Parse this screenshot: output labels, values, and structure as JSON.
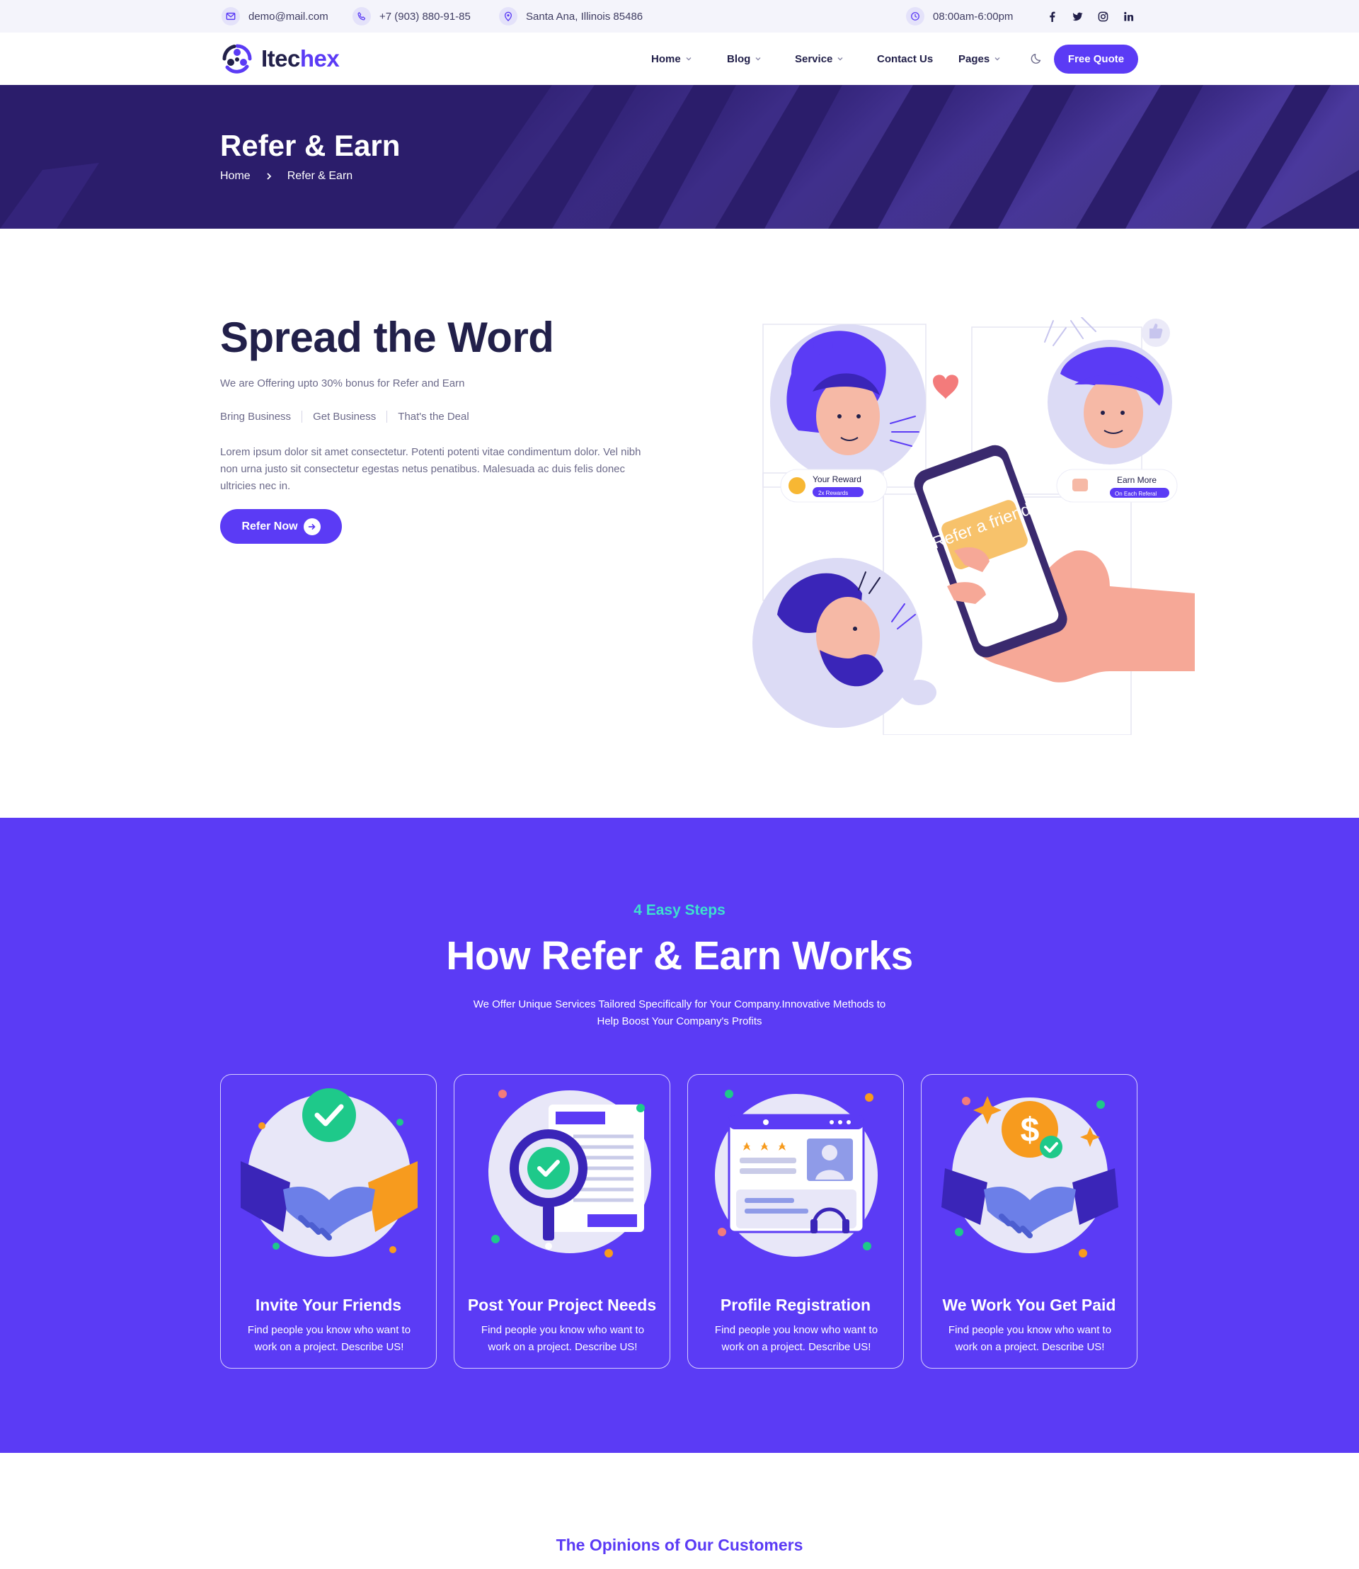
{
  "topbar": {
    "email": "demo@mail.com",
    "phone": "+7 (903) 880-91-85",
    "address": "Santa Ana, Illinois 85486",
    "hours": "08:00am-6:00pm",
    "social": [
      "facebook-icon",
      "twitter-icon",
      "instagram-icon",
      "linkedin-icon"
    ]
  },
  "header": {
    "logo_prefix": "Itec",
    "logo_suffix": "hex",
    "nav": [
      {
        "label": "Home",
        "dropdown": true
      },
      {
        "label": "Blog",
        "dropdown": true
      },
      {
        "label": "Service",
        "dropdown": true
      },
      {
        "label": "Contact Us",
        "dropdown": false
      },
      {
        "label": "Pages",
        "dropdown": true
      }
    ],
    "cta": "Free Quote"
  },
  "banner": {
    "title": "Refer & Earn",
    "breadcrumb": [
      "Home",
      "Refer & Earn"
    ]
  },
  "spread": {
    "title": "Spread the Word",
    "subtitle": "We are Offering upto 30% bonus for Refer and Earn",
    "tags": [
      "Bring Business",
      "Get Business",
      "That's the Deal"
    ],
    "body": "Lorem ipsum dolor sit amet consectetur. Potenti potenti vitae condimentum dolor. Vel nibh non urna justo sit consectetur egestas netus penatibus. Malesuada ac duis felis donec ultricies nec in.",
    "button": "Refer Now",
    "illustration": {
      "reward_label": "Your Reward",
      "reward_pill": "2x Rewards",
      "earn_label": "Earn More",
      "earn_pill": "On Each Referal",
      "phone_text": "Refer a friend"
    }
  },
  "how": {
    "kicker": "4 Easy Steps",
    "title": "How Refer & Earn Works",
    "description": "We Offer Unique Services Tailored Specifically for Your Company.Innovative Methods to Help Boost Your Company's Profits",
    "steps": [
      {
        "title": "Invite Your Friends",
        "text": "Find people you know who want to work on a project. Describe US!"
      },
      {
        "title": "Post Your Project Needs",
        "text": "Find people you know who want to work on a project. Describe US!"
      },
      {
        "title": "Profile Registration",
        "text": "Find people you know who want to work on a project. Describe US!"
      },
      {
        "title": "We Work You Get Paid",
        "text": "Find people you know who want to work on a project. Describe US!"
      }
    ]
  },
  "opinions": {
    "title": "The Opinions of Our Customers"
  },
  "colors": {
    "primary": "#5b3bf5",
    "dark": "#22204a",
    "banner": "#2b1d6b",
    "accent": "#3ee0ce"
  }
}
